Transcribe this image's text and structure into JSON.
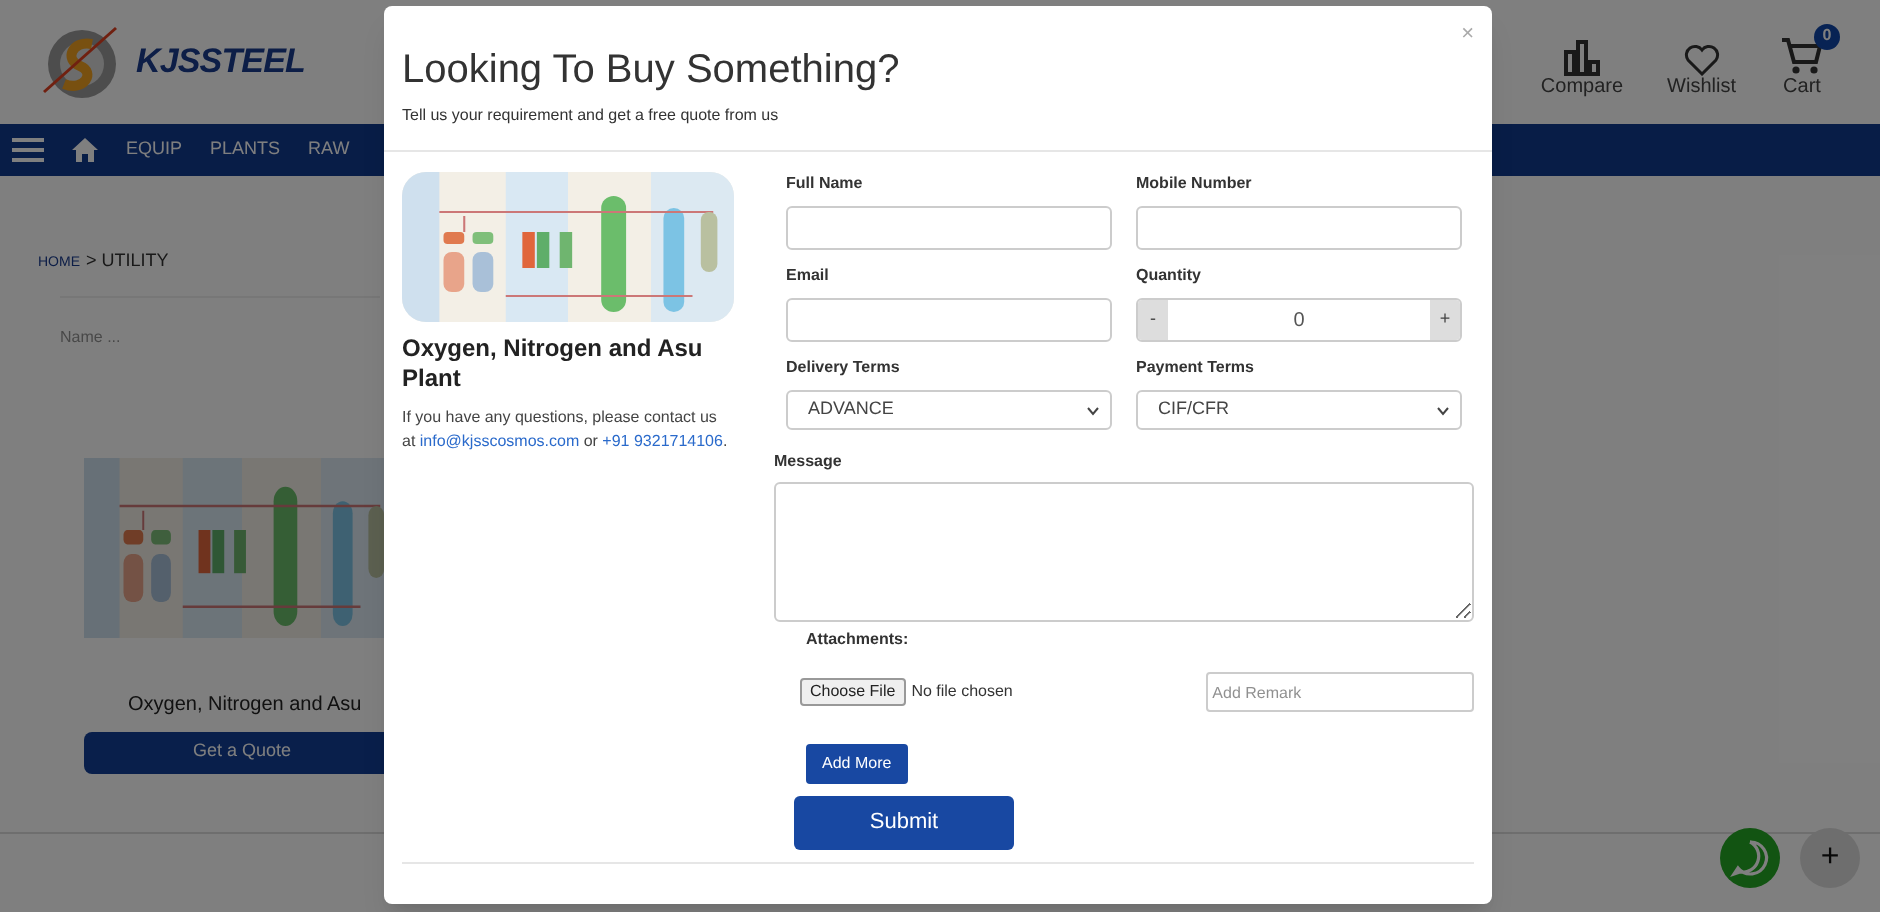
{
  "site": {
    "logo_text": "KJSSTEEL",
    "header_actions": [
      {
        "kind": "compare",
        "label": "Compare"
      },
      {
        "kind": "wishlist",
        "label": "Wishlist"
      },
      {
        "kind": "cart",
        "label": "Cart",
        "badge": "0"
      }
    ],
    "nav": [
      "EQUIP",
      "PLANTS",
      "RAW"
    ],
    "breadcrumb": {
      "home": "HOME",
      "current": "> UTILITY"
    },
    "search": {
      "placeholder": "Name ..."
    },
    "product": {
      "title": "Oxygen, Nitrogen and Asu",
      "button": "Get a Quote"
    },
    "float_plus": "+"
  },
  "modal": {
    "title": "Looking To Buy Something?",
    "subtitle": "Tell us your requirement and get a free quote from us",
    "close": "×",
    "product": {
      "title": "Oxygen, Nitrogen and Asu Plant",
      "contact_before": "If you have any questions, please contact us at",
      "email": "info@kjsscosmos.com",
      "contact_mid": "or",
      "phone": "+91 9321714106",
      "contact_after": "."
    },
    "fields": [
      {
        "kind": "text",
        "label": "Full Name"
      },
      {
        "kind": "text",
        "label": "Mobile Number"
      },
      {
        "kind": "text",
        "label": "Email"
      },
      {
        "kind": "stepper",
        "label": "Quantity",
        "value": "0",
        "minus": "-",
        "plus": "+"
      },
      {
        "kind": "select",
        "label": "Delivery Terms",
        "value": "ADVANCE"
      },
      {
        "kind": "select",
        "label": "Payment Terms",
        "value": "CIF/CFR"
      }
    ],
    "message_label": "Message",
    "attachments_label": "Attachments:",
    "file_button": "Choose File",
    "file_status": "No file chosen",
    "remark": {
      "placeholder": "Add Remark"
    },
    "add_more": "Add More",
    "submit": "Submit"
  }
}
